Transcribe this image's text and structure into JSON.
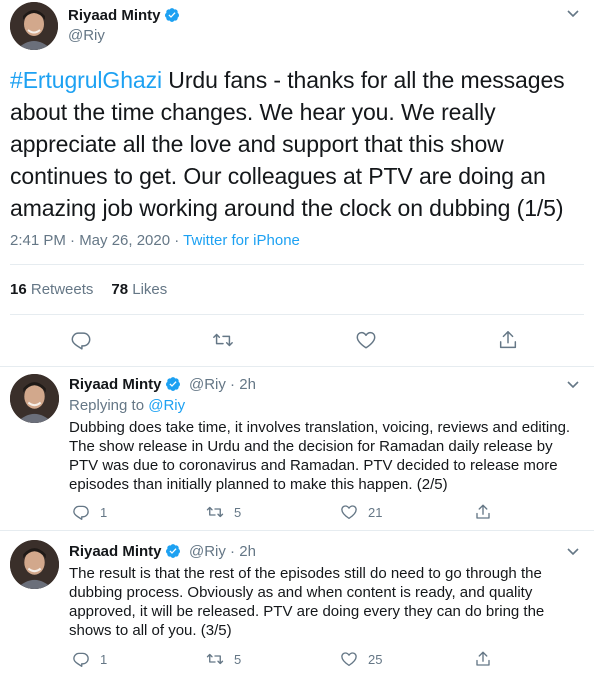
{
  "main_tweet": {
    "name": "Riyaad Minty",
    "handle": "@Riy",
    "hashtag": "#ErtugrulGhazi",
    "text": " Urdu fans - thanks for all the messages about the time changes. We hear you. We really appreciate all the love and support that this show continues to get. Our colleagues at PTV are doing an amazing job working around the clock on dubbing (1/5)",
    "timestamp": "2:41 PM · May 26, 2020 · ",
    "source": "Twitter for iPhone",
    "retweets_count": "16",
    "retweets_label": " Retweets",
    "likes_count": "78",
    "likes_label": " Likes"
  },
  "replies": [
    {
      "name": "Riyaad Minty",
      "handle_time": "@Riy · 2h",
      "replying_label": "Replying to ",
      "replying_handle": "@Riy",
      "text": "Dubbing does take time, it involves translation, voicing, reviews and editing. The show release in Urdu and the decision for Ramadan daily release by PTV was due to coronavirus and Ramadan. PTV decided to release more episodes than initially planned to make this happen. (2/5)",
      "reply_count": "1",
      "retweet_count": "5",
      "like_count": "21"
    },
    {
      "name": "Riyaad Minty",
      "handle_time": "@Riy · 2h",
      "text": "The result is that the rest of the episodes still do need to go through the dubbing process. Obviously as and when content is ready, and quality approved, it will be released. PTV are doing every they can do bring the shows to all of you. (3/5)",
      "reply_count": "1",
      "retweet_count": "5",
      "like_count": "25"
    }
  ],
  "colors": {
    "accent": "#1da1f2",
    "secondary_text": "#657786",
    "primary_text": "#14171a",
    "border": "#e6ecf0"
  },
  "icons": [
    "verified-badge-icon",
    "chevron-down-icon",
    "reply-icon",
    "retweet-icon",
    "like-icon",
    "share-icon"
  ]
}
